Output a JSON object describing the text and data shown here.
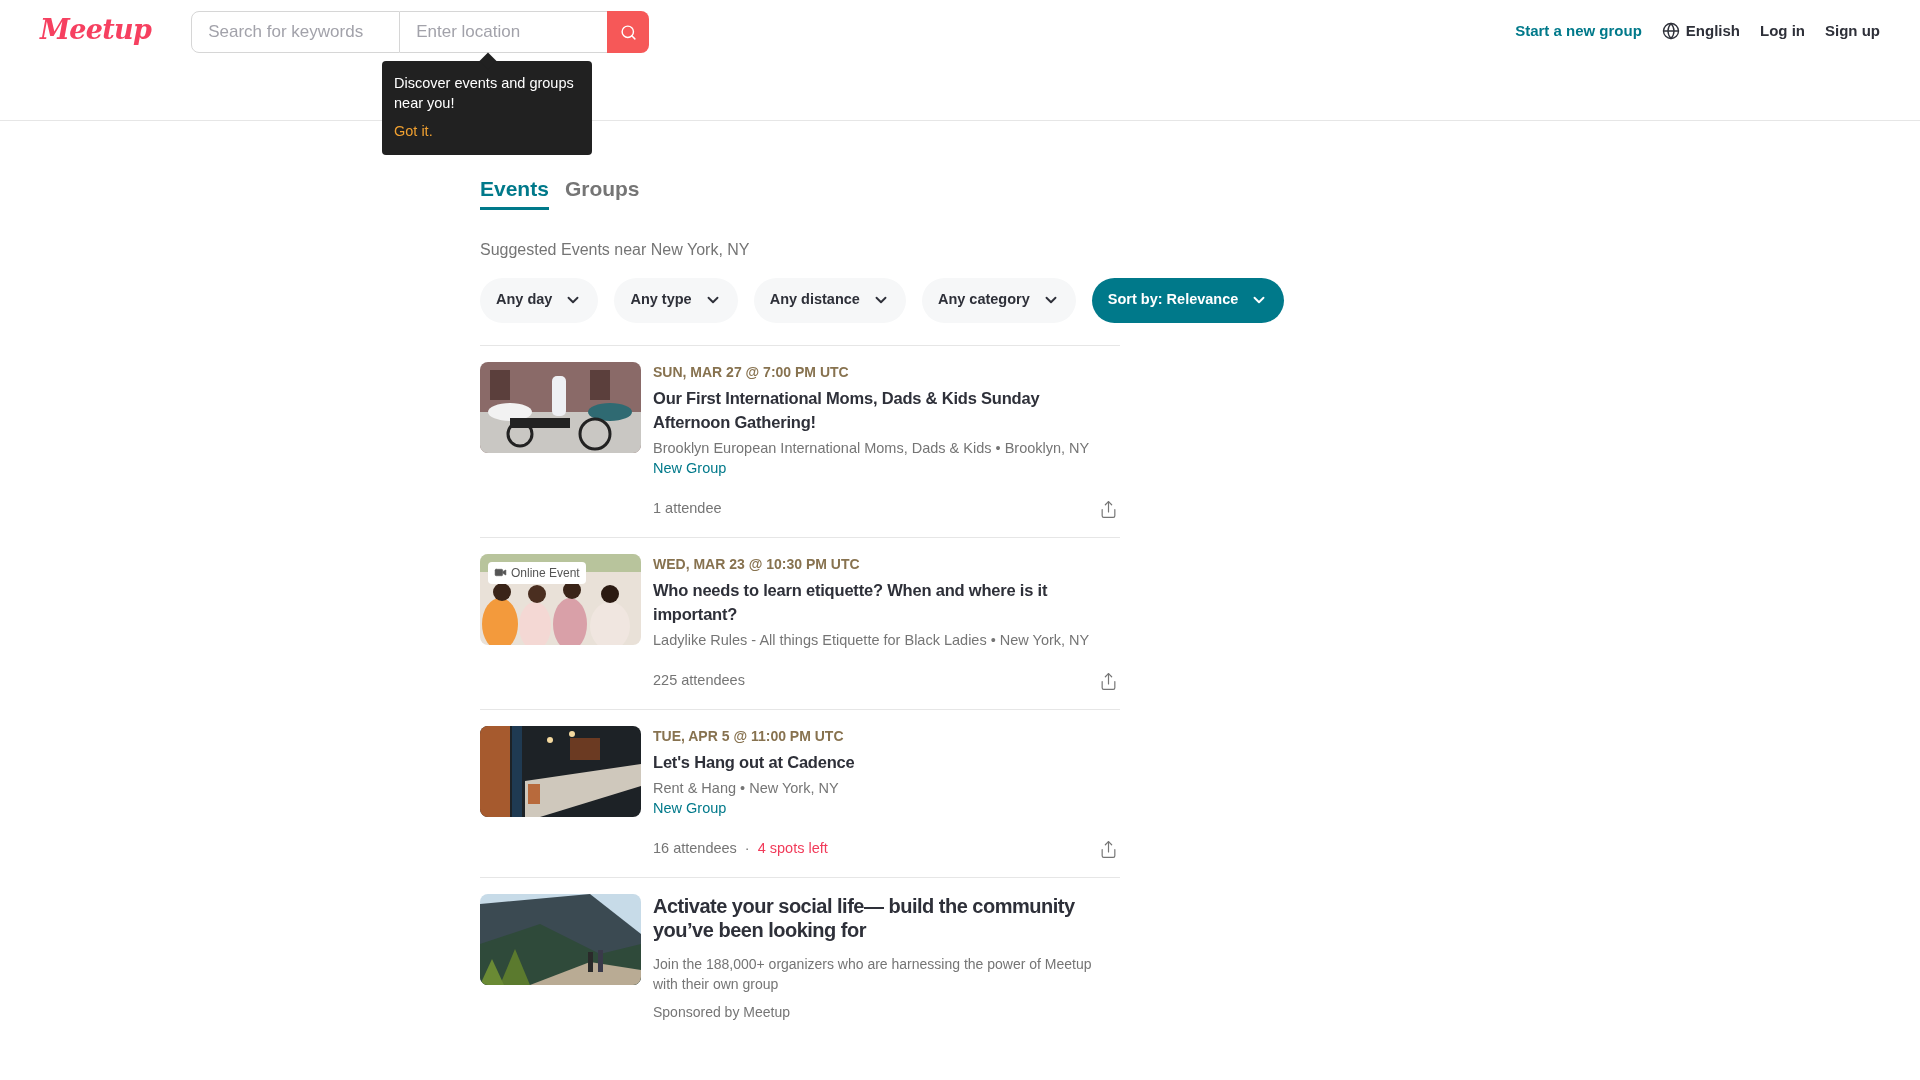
{
  "header": {
    "logo": "Meetup",
    "search": {
      "keyword_placeholder": "Search for keywords",
      "location_placeholder": "Enter location"
    },
    "tooltip": {
      "message": "Discover events and groups near you!",
      "action": "Got it."
    },
    "nav": [
      {
        "label": "Start a new group",
        "kind": "accent"
      },
      {
        "label": "English",
        "kind": "language"
      },
      {
        "label": "Log in",
        "kind": "plain"
      },
      {
        "label": "Sign up",
        "kind": "plain"
      }
    ]
  },
  "tabs": [
    {
      "label": "Events",
      "selected": true
    },
    {
      "label": "Groups",
      "selected": false
    }
  ],
  "subtitle": "Suggested Events near New York, NY",
  "filters": [
    {
      "label": "Any day",
      "selected": false
    },
    {
      "label": "Any type",
      "selected": false
    },
    {
      "label": "Any distance",
      "selected": false
    },
    {
      "label": "Any category",
      "selected": false
    },
    {
      "label": "Sort by: Relevance",
      "selected": true
    }
  ],
  "events": [
    {
      "kind": "event",
      "date": "SUN, MAR 27 @ 7:00 PM UTC",
      "title": "Our First International Moms, Dads & Kids Sunday Afternoon Gathering!",
      "group": "Brooklyn European International Moms, Dads & Kids • Brooklyn, NY",
      "tag": "New Group",
      "attendees": "1 attendee"
    },
    {
      "kind": "event",
      "badge": "Online Event",
      "date": "WED, MAR 23 @ 10:30 PM UTC",
      "title": "Who needs to learn etiquette? When and where is it important?",
      "group": "Ladylike Rules - All things Etiquette for Black Ladies • New York, NY",
      "attendees": "225 attendees"
    },
    {
      "kind": "event",
      "date": "TUE, APR 5 @ 11:00 PM UTC",
      "title": "Let's Hang out at Cadence",
      "group": "Rent & Hang • New York, NY",
      "tag": "New Group",
      "attendees": "16 attendees",
      "separator": "·",
      "spots": "4 spots left"
    },
    {
      "kind": "sponsored",
      "title": "Activate your social life— build the community you’ve been looking for",
      "description": "Join the 188,000+ organizers who are harnessing the power of Meetup with their own group",
      "sponsor": "Sponsored by Meetup"
    }
  ]
}
